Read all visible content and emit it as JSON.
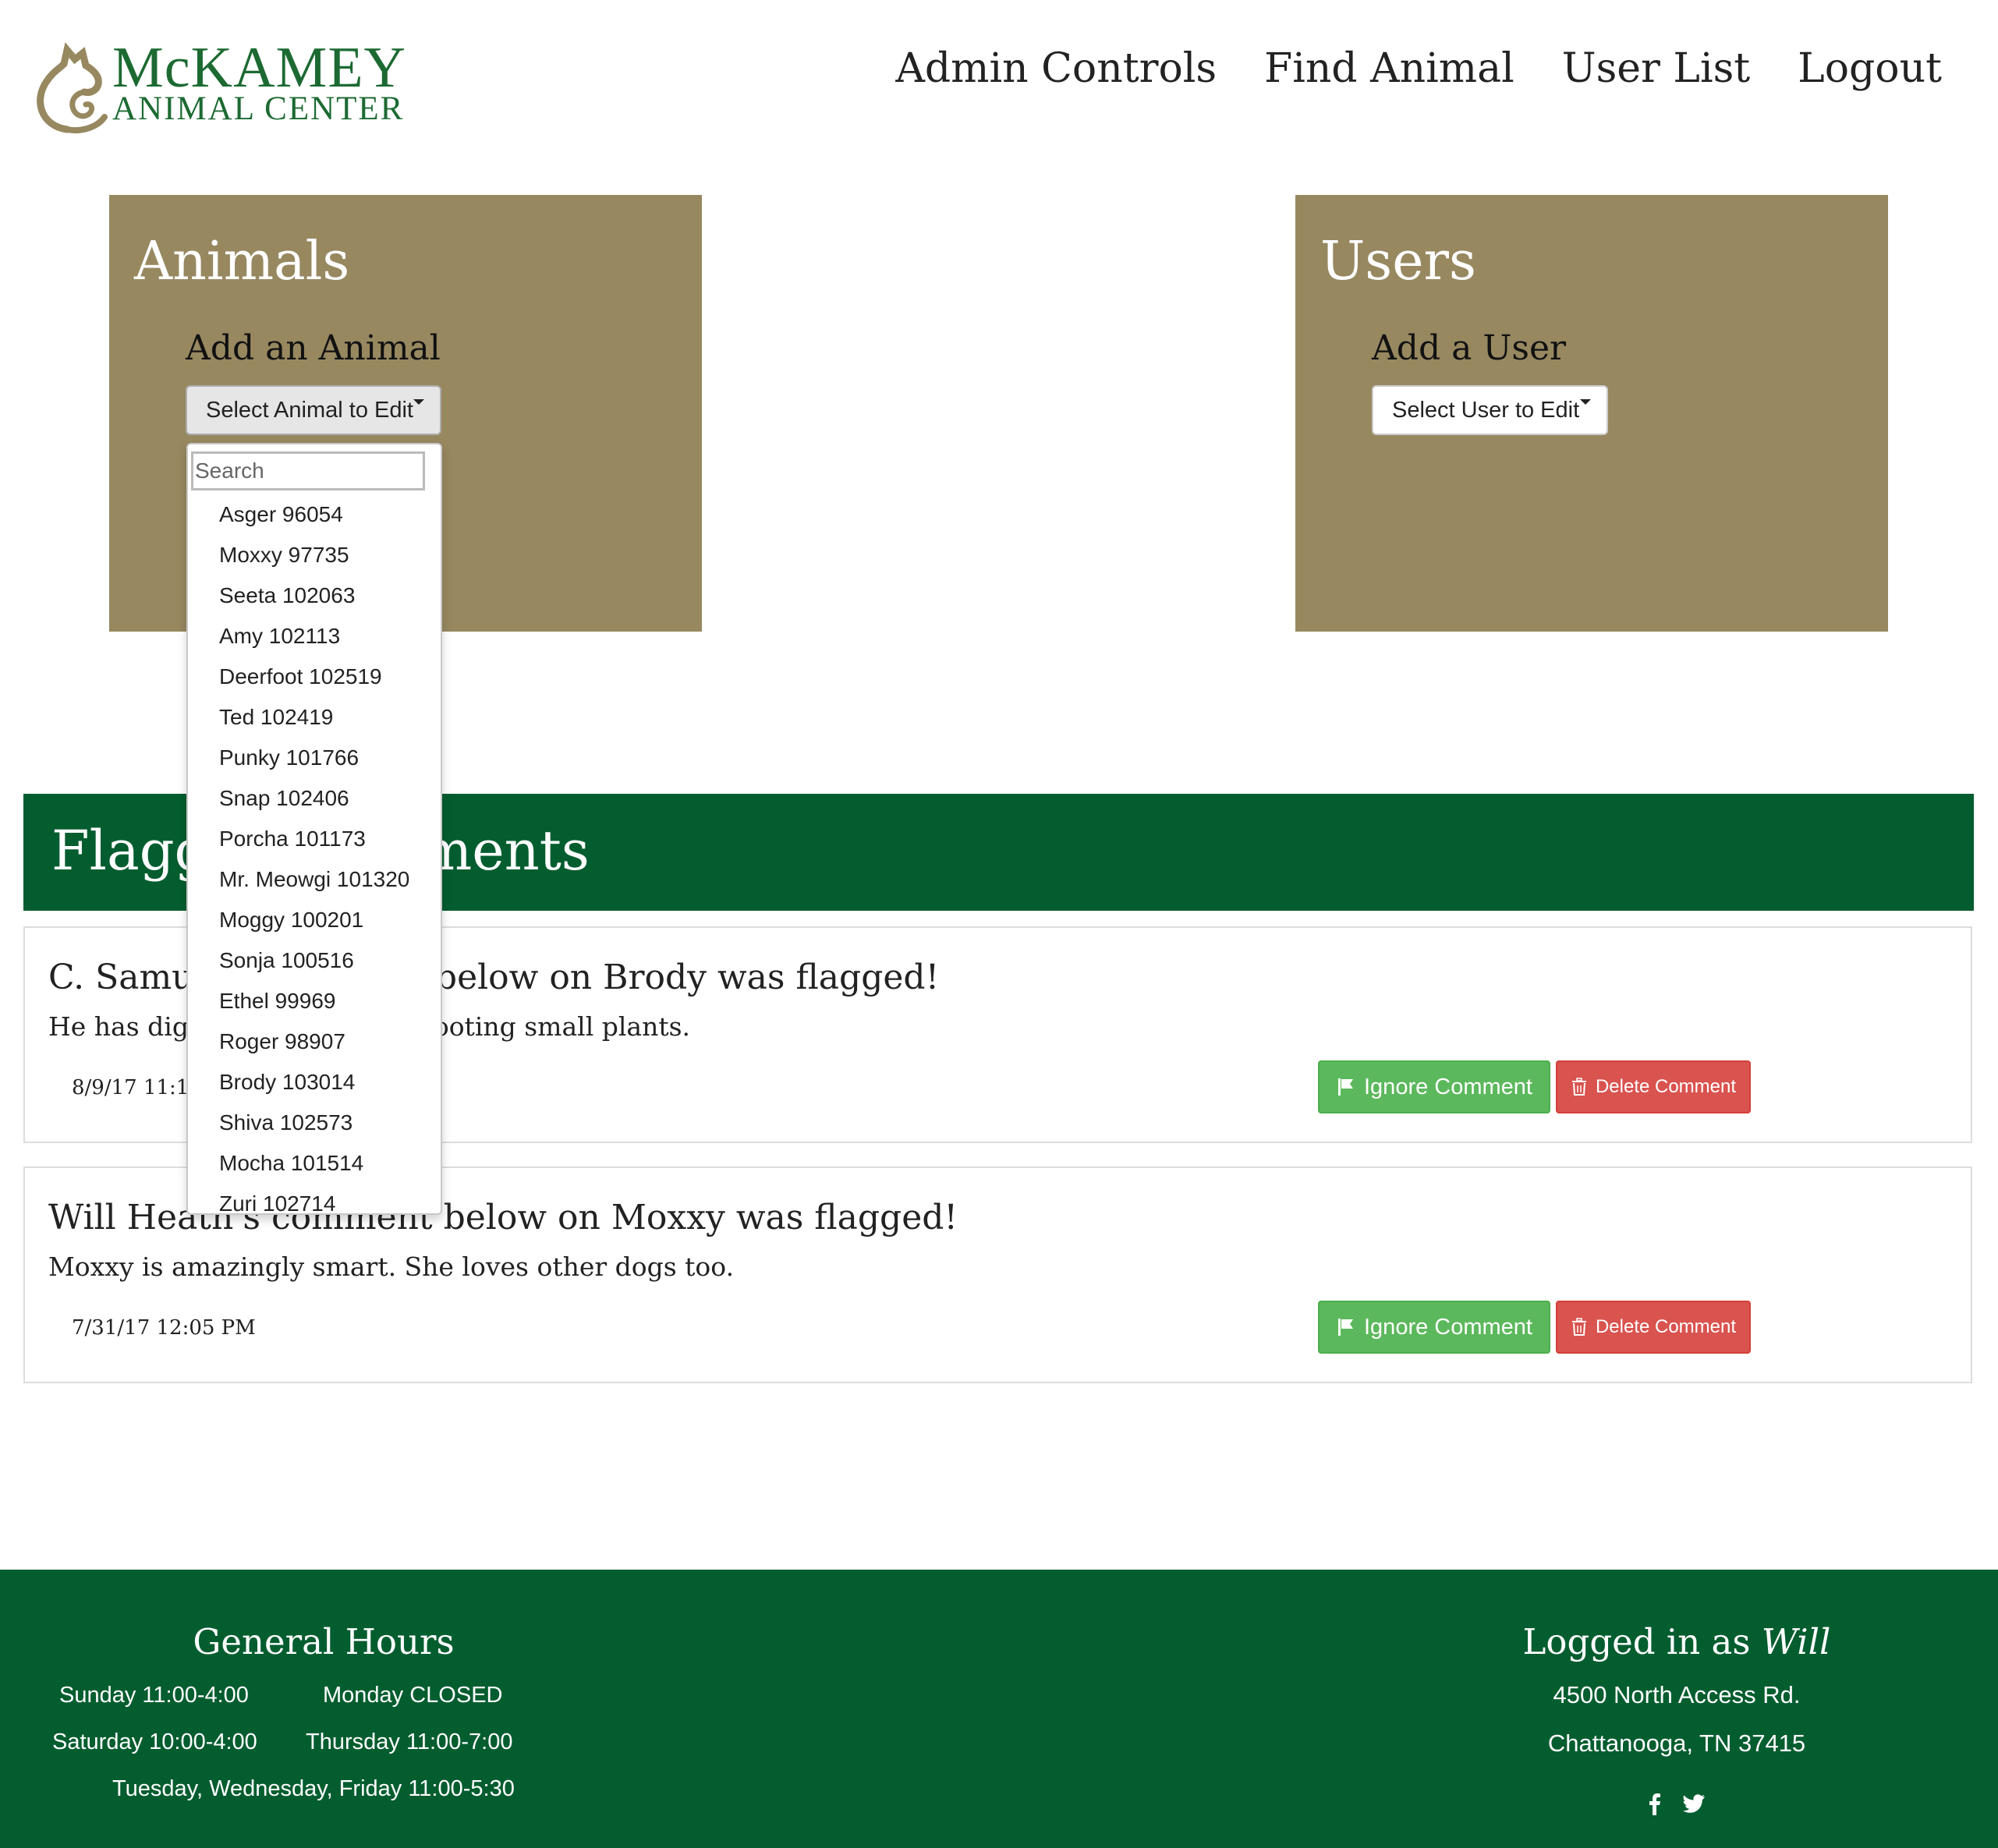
{
  "header": {
    "logo_line1": "McKAMEY",
    "logo_line2": "ANIMAL CENTER",
    "nav": [
      "Admin Controls",
      "Find Animal",
      "User List",
      "Logout"
    ]
  },
  "animals_panel": {
    "title": "Animals",
    "add_link": "Add an Animal",
    "select_label": "Select Animal to Edit"
  },
  "users_panel": {
    "title": "Users",
    "add_link": "Add a User",
    "select_label": "Select User to Edit"
  },
  "dropdown": {
    "search_placeholder": "Search",
    "items": [
      "Asger 96054",
      "Moxxy 97735",
      "Seeta 102063",
      "Amy 102113",
      "Deerfoot 102519",
      "Ted 102419",
      "Punky 101766",
      "Snap 102406",
      "Porcha 101173",
      "Mr. Meowgi 101320",
      "Moggy 100201",
      "Sonja 100516",
      "Ethel 99969",
      "Roger 98907",
      "Brody 103014",
      "Shiva 102573",
      "Mocha 101514",
      "Zuri 102714"
    ]
  },
  "flagged": {
    "title": "Flagged Comments",
    "comments": [
      {
        "heading": "C. Samuel's comment below on Brody was flagged!",
        "body": "He has digging holes and uprooting small plants.",
        "time": "8/9/17 11:17 AM",
        "ignore_label": "Ignore Comment",
        "delete_label": "Delete Comment"
      },
      {
        "heading": "Will Heath's comment below on Moxxy was flagged!",
        "body": "Moxxy is amazingly smart. She loves other dogs too.",
        "time": "7/31/17 12:05 PM",
        "ignore_label": "Ignore Comment",
        "delete_label": "Delete Comment"
      }
    ]
  },
  "footer": {
    "hours_title": "General Hours",
    "hours": {
      "sunday": "Sunday 11:00-4:00",
      "monday": "Monday CLOSED",
      "saturday": "Saturday 10:00-4:00",
      "thursday": "Thursday 11:00-7:00",
      "weekdays": "Tuesday, Wednesday, Friday 11:00-5:30"
    },
    "logged_in_prefix": "Logged in as",
    "logged_in_user": "Will",
    "address_line1": "4500 North Access Rd.",
    "address_line2": "Chattanooga, TN 37415",
    "social_icons": [
      "facebook-icon",
      "twitter-icon"
    ]
  },
  "colors": {
    "brand_green": "#045d2f",
    "panel_tan": "#978860",
    "success": "#5cb85c",
    "danger": "#d9534f"
  }
}
